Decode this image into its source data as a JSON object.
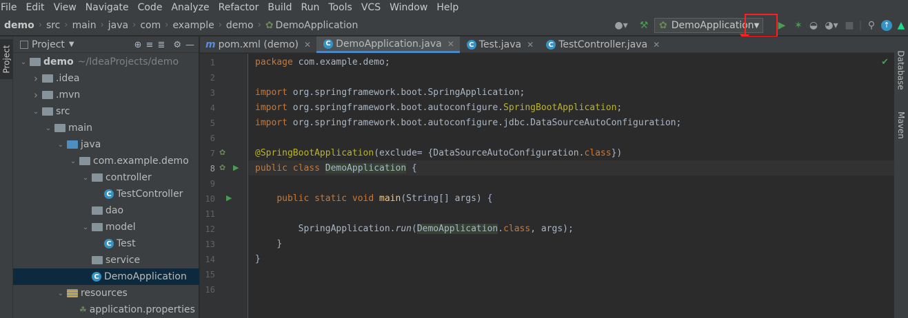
{
  "menu": [
    "File",
    "Edit",
    "View",
    "Navigate",
    "Code",
    "Analyze",
    "Refactor",
    "Build",
    "Run",
    "Tools",
    "VCS",
    "Window",
    "Help"
  ],
  "breadcrumb": [
    "demo",
    "src",
    "main",
    "java",
    "com",
    "example",
    "demo",
    "DemoApplication"
  ],
  "run_config": "DemoApplication",
  "project_panel": {
    "title": "Project",
    "tree": [
      {
        "label": "demo",
        "suffix": "~/IdeaProjects/demo",
        "depth": 0,
        "kind": "module",
        "expanded": true,
        "bold": true
      },
      {
        "label": ".idea",
        "depth": 1,
        "kind": "folder",
        "expanded": false
      },
      {
        "label": ".mvn",
        "depth": 1,
        "kind": "folder",
        "expanded": false
      },
      {
        "label": "src",
        "depth": 1,
        "kind": "folder",
        "expanded": true
      },
      {
        "label": "main",
        "depth": 2,
        "kind": "folder",
        "expanded": true
      },
      {
        "label": "java",
        "depth": 3,
        "kind": "source-folder",
        "expanded": true
      },
      {
        "label": "com.example.demo",
        "depth": 4,
        "kind": "package",
        "expanded": true
      },
      {
        "label": "controller",
        "depth": 5,
        "kind": "package",
        "expanded": true
      },
      {
        "label": "TestController",
        "depth": 6,
        "kind": "class"
      },
      {
        "label": "dao",
        "depth": 5,
        "kind": "package"
      },
      {
        "label": "model",
        "depth": 5,
        "kind": "package",
        "expanded": true
      },
      {
        "label": "Test",
        "depth": 6,
        "kind": "class"
      },
      {
        "label": "service",
        "depth": 5,
        "kind": "package"
      },
      {
        "label": "DemoApplication",
        "depth": 5,
        "kind": "spring-class",
        "selected": true
      },
      {
        "label": "resources",
        "depth": 3,
        "kind": "resources-folder",
        "expanded": true
      },
      {
        "label": "application.properties",
        "depth": 4,
        "kind": "properties"
      }
    ]
  },
  "tabs": [
    {
      "label": "pom.xml (demo)",
      "icon": "m",
      "active": false
    },
    {
      "label": "DemoApplication.java",
      "icon": "spring",
      "active": true
    },
    {
      "label": "Test.java",
      "icon": "c",
      "active": false
    },
    {
      "label": "TestController.java",
      "icon": "c",
      "active": false
    }
  ],
  "line_numbers": [
    "1",
    "2",
    "3",
    "4",
    "5",
    "6",
    "7",
    "8",
    "9",
    "10",
    "11",
    "12",
    "13",
    "14",
    "15",
    "16"
  ],
  "code": {
    "l1_kw": "package",
    "l1_rest": " com.example.demo;",
    "l3_kw": "import",
    "l3_rest": " org.springframework.boot.SpringApplication;",
    "l4_kw": "import",
    "l4_mid": " org.springframework.boot.autoconfigure.",
    "l4_ann": "SpringBootApplication",
    "l4_end": ";",
    "l5_kw": "import",
    "l5_rest": " org.springframework.boot.autoconfigure.jdbc.DataSourceAutoConfiguration;",
    "l7_ann": "@SpringBootApplication",
    "l7_mid": "(exclude= {DataSourceAutoConfiguration.",
    "l7_kw": "class",
    "l7_end": "})",
    "l8_kw": "public class",
    "l8_name": "DemoApplication",
    "l8_end": " {",
    "l10_kw": "public static void",
    "l10_fn": "main",
    "l10_rest": "(String[] args) {",
    "l12_pre": "SpringApplication.",
    "l12_run": "run",
    "l12_open": "(",
    "l12_cls": "DemoApplication",
    "l12_dot": ".",
    "l12_kw": "class",
    "l12_end": ", args);",
    "l13": "}",
    "l14": "}"
  },
  "right_tabs": [
    "Database",
    "Maven"
  ],
  "left_tab": "Project",
  "colors": {
    "highlight_box": "#ff1f1f",
    "run_green": "#499c54"
  }
}
